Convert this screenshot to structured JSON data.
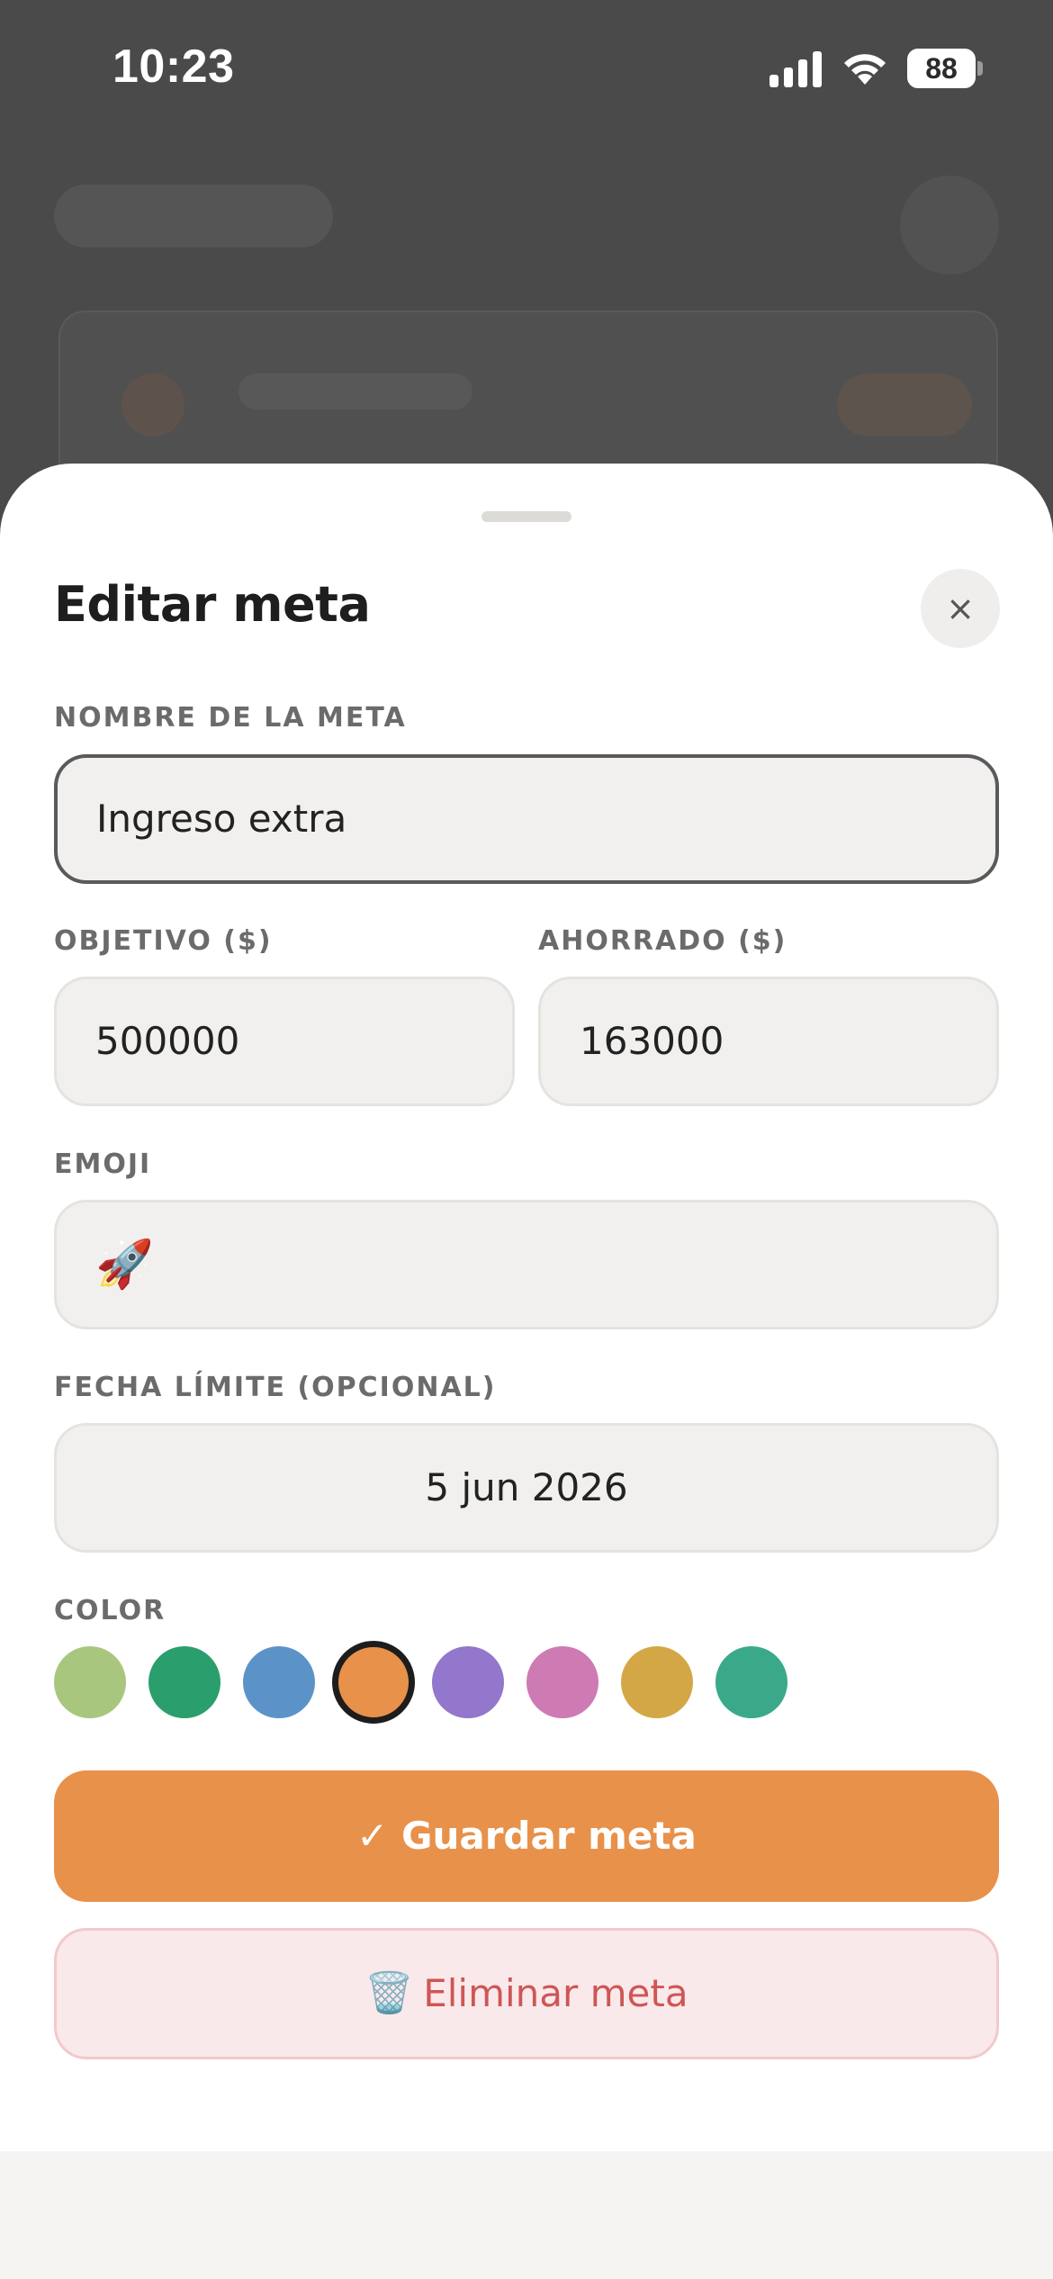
{
  "status_bar": {
    "time": "10:23",
    "battery": "88"
  },
  "sheet": {
    "title": "Editar meta",
    "close_icon": "×"
  },
  "form": {
    "name": {
      "label": "NOMBRE DE LA META",
      "value": "Ingreso extra"
    },
    "target": {
      "label": "OBJETIVO ($)",
      "value": "500000"
    },
    "saved": {
      "label": "AHORRADO ($)",
      "value": "163000"
    },
    "emoji": {
      "label": "EMOJI",
      "value": "🚀"
    },
    "deadline": {
      "label": "FECHA LÍMITE (OPCIONAL)",
      "value": "5 jun 2026"
    },
    "color": {
      "label": "COLOR",
      "swatches": [
        "#a9c67e",
        "#2a9e6c",
        "#5b93c9",
        "#e8914a",
        "#9277cc",
        "#ce7ab3",
        "#d4a746",
        "#3aa98a"
      ],
      "selected": "#e8914a"
    }
  },
  "actions": {
    "save_label": "✓ Guardar meta",
    "delete_icon": "🗑️",
    "delete_label": "Eliminar meta"
  }
}
